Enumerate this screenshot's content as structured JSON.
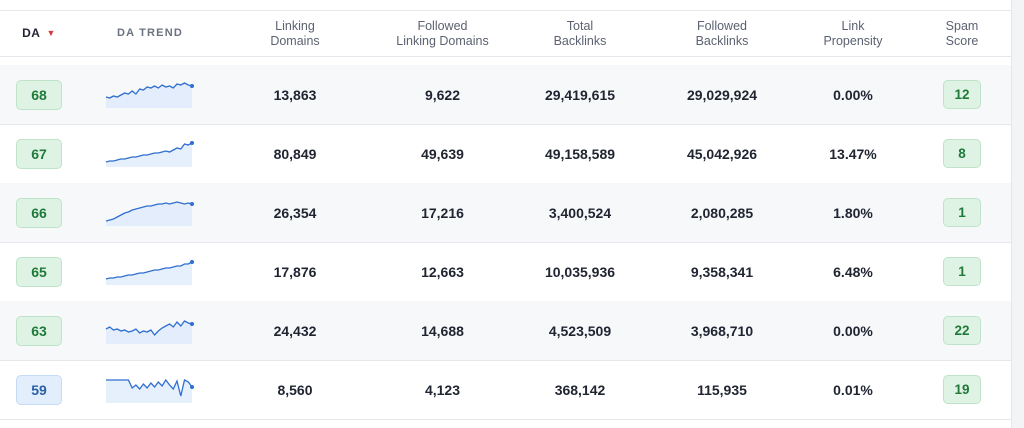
{
  "header": {
    "da": "DA",
    "da_sort": "▼",
    "trend": "DA TREND",
    "linking_domains": "Linking\nDomains",
    "followed_linking_domains": "Followed\nLinking Domains",
    "total_backlinks": "Total\nBacklinks",
    "followed_backlinks": "Followed\nBacklinks",
    "link_propensity": "Link\nPropensity",
    "spam_score": "Spam\nScore"
  },
  "colors": {
    "green_badge": "#dff3e4",
    "blue_badge": "#e2eefc",
    "trend_line": "#2f6fd0",
    "sort_arrow": "#d43d3d"
  },
  "rows": [
    {
      "da": "68",
      "da_color": "green",
      "linking_domains": "13,863",
      "followed_linking_domains": "9,622",
      "total_backlinks": "29,419,615",
      "followed_backlinks": "29,029,924",
      "link_propensity": "0.00%",
      "spam_score": "12",
      "trend": [
        10,
        9,
        11,
        10,
        12,
        14,
        13,
        16,
        13,
        18,
        17,
        20,
        19,
        21,
        19,
        22,
        20,
        21,
        19,
        23,
        22,
        24,
        22,
        21
      ]
    },
    {
      "da": "67",
      "da_color": "green",
      "linking_domains": "80,849",
      "followed_linking_domains": "49,639",
      "total_backlinks": "49,158,589",
      "followed_backlinks": "45,042,926",
      "link_propensity": "13.47%",
      "spam_score": "8",
      "trend": [
        4,
        5,
        5,
        6,
        7,
        7,
        8,
        9,
        9,
        10,
        11,
        11,
        12,
        13,
        13,
        14,
        15,
        14,
        16,
        18,
        17,
        22,
        21,
        23
      ]
    },
    {
      "da": "66",
      "da_color": "green",
      "linking_domains": "26,354",
      "followed_linking_domains": "17,216",
      "total_backlinks": "3,400,524",
      "followed_backlinks": "2,080,285",
      "link_propensity": "1.80%",
      "spam_score": "1",
      "trend": [
        4,
        5,
        6,
        8,
        10,
        12,
        13,
        15,
        16,
        17,
        18,
        19,
        19,
        20,
        21,
        21,
        22,
        21,
        22,
        23,
        22,
        21,
        22,
        21
      ]
    },
    {
      "da": "65",
      "da_color": "green",
      "linking_domains": "17,876",
      "followed_linking_domains": "12,663",
      "total_backlinks": "10,035,936",
      "followed_backlinks": "9,358,341",
      "link_propensity": "6.48%",
      "spam_score": "1",
      "trend": [
        5,
        6,
        6,
        7,
        7,
        8,
        9,
        9,
        10,
        11,
        11,
        12,
        13,
        14,
        14,
        15,
        16,
        16,
        17,
        18,
        18,
        20,
        20,
        22
      ]
    },
    {
      "da": "63",
      "da_color": "green",
      "linking_domains": "24,432",
      "followed_linking_domains": "14,688",
      "total_backlinks": "4,523,509",
      "followed_backlinks": "3,968,710",
      "link_propensity": "0.00%",
      "spam_score": "22",
      "trend": [
        14,
        16,
        13,
        14,
        12,
        13,
        11,
        12,
        14,
        10,
        12,
        11,
        13,
        8,
        12,
        15,
        17,
        19,
        16,
        21,
        17,
        22,
        20,
        19
      ]
    },
    {
      "da": "59",
      "da_color": "blue",
      "linking_domains": "8,560",
      "followed_linking_domains": "4,123",
      "total_backlinks": "368,142",
      "followed_backlinks": "115,935",
      "link_propensity": "0.01%",
      "spam_score": "19",
      "trend": [
        22,
        22,
        22,
        22,
        22,
        22,
        22,
        14,
        17,
        13,
        18,
        14,
        19,
        15,
        20,
        16,
        22,
        17,
        13,
        21,
        6,
        22,
        20,
        15
      ]
    }
  ]
}
